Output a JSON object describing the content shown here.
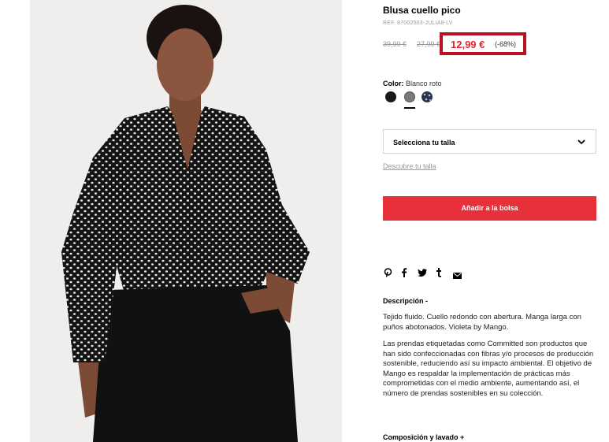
{
  "product": {
    "title": "Blusa cuello pico",
    "ref": "REF. 87002503-JULIA8-LV",
    "original_price": "39,99 €",
    "previous_price": "27,99 €",
    "current_price": "12,99 €",
    "discount": "(-68%)",
    "accent_color": "#e3262e",
    "highlight_border_color": "#b7121f"
  },
  "color": {
    "label": "Color:",
    "selected": "Blanco roto",
    "swatches": [
      {
        "name": "black",
        "hex": "#1a1a1a"
      },
      {
        "name": "grey",
        "hex": "#7a7a7a"
      },
      {
        "name": "navy-print",
        "hex": "#2a3350"
      }
    ]
  },
  "size": {
    "select_label": "Selecciona tu talla",
    "guide_link": "Descubre tu talla"
  },
  "cart": {
    "add_button": "Añadir a la bolsa",
    "button_color": "#e8303a"
  },
  "share": {
    "icons": [
      "pinterest-icon",
      "facebook-icon",
      "twitter-icon",
      "tumblr-icon",
      "email-icon"
    ]
  },
  "description": {
    "title": "Descripción -",
    "p1": "Tejido fluido. Cuello redondo con abertura. Manga larga con puños abotonados. Violeta by Mango.",
    "p2": "Las prendas etiquetadas como Committed son productos que han sido confeccionadas con fibras y/o procesos de producción sostenible, reduciendo así su impacto ambiental. El objetivo de Mango es respaldar la implementación de prácticas más comprometidas con el medio ambiente, aumentando así, el número de prendas sostenibles en su colección."
  },
  "composition": {
    "title": "Composición y lavado +"
  }
}
